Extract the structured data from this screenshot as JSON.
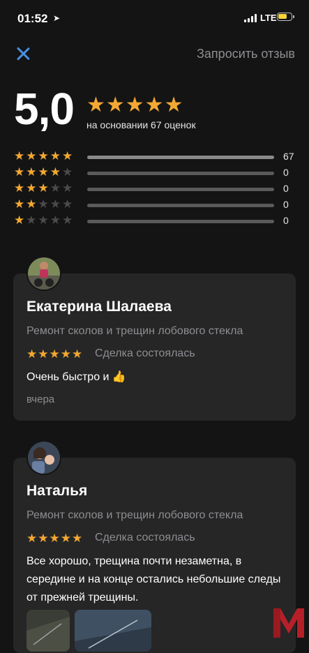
{
  "status": {
    "time": "01:52",
    "network": "LTE"
  },
  "header": {
    "request_review": "Запросить отзыв"
  },
  "summary": {
    "rating": "5,0",
    "stars": "★★★★★",
    "based_on": "на основании 67 оценок"
  },
  "distribution": [
    {
      "stars": 5,
      "count": "67",
      "fraction": 1.0
    },
    {
      "stars": 4,
      "count": "0",
      "fraction": 0
    },
    {
      "stars": 3,
      "count": "0",
      "fraction": 0
    },
    {
      "stars": 2,
      "count": "0",
      "fraction": 0
    },
    {
      "stars": 1,
      "count": "0",
      "fraction": 0
    }
  ],
  "reviews": [
    {
      "name": "Екатерина Шалаева",
      "service": "Ремонт сколов и трещин лобового стекла",
      "stars": "★★★★★",
      "status": "Сделка состоялась",
      "text": "Очень быстро и 👍",
      "date": "вчера"
    },
    {
      "name": "Наталья",
      "service": "Ремонт сколов и трещин лобового стекла",
      "stars": "★★★★★",
      "status": "Сделка состоялась",
      "text": "Все хорошо, трещина почти незаметна, в середине и на конце остались небольшие следы от прежней трещины."
    }
  ],
  "colors": {
    "accent_blue": "#4a90e2",
    "star": "#f3a833",
    "card": "#262626",
    "background": "#141414"
  }
}
